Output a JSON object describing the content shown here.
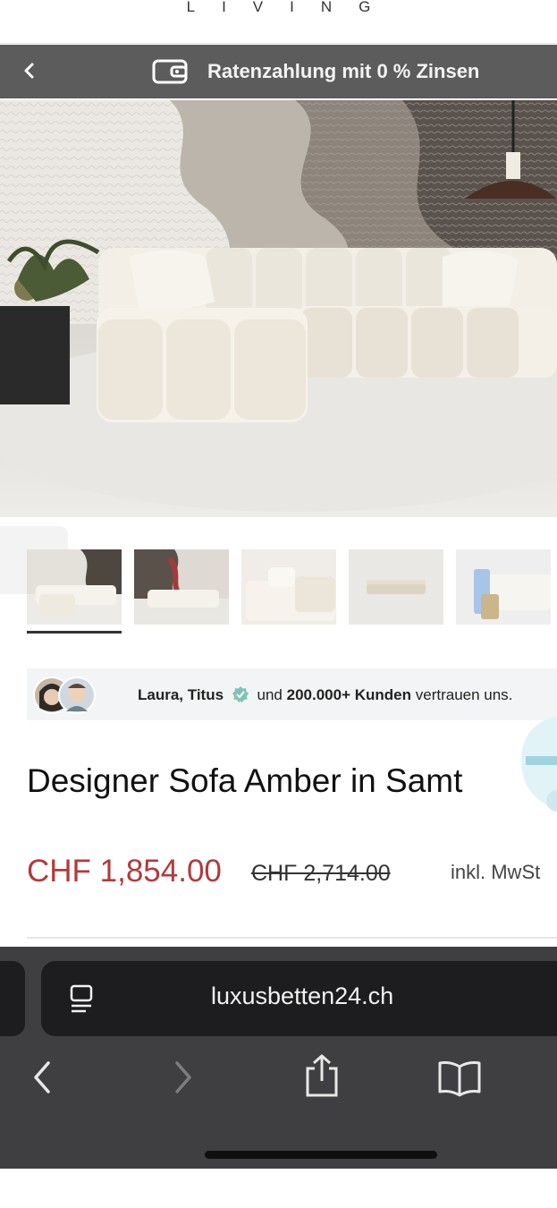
{
  "header": {
    "brand_sub": "LIVING"
  },
  "promo": {
    "text": "Ratenzahlung mit 0 % Zinsen"
  },
  "trust": {
    "names": "Laura, Titus",
    "middle": "und",
    "count": "200.000+ Kunden",
    "suffix": "vertrauen uns."
  },
  "product": {
    "title": "Designer Sofa Amber in Samt",
    "price": "CHF 1,854.00",
    "old_price": "CHF 2,714.00",
    "tax_note": "inkl. MwSt"
  },
  "browser": {
    "url": "luxusbetten24.ch"
  },
  "colors": {
    "promo_bg": "#5c5c5c",
    "price": "#b3393b",
    "browser_bg": "#3f3f41"
  }
}
